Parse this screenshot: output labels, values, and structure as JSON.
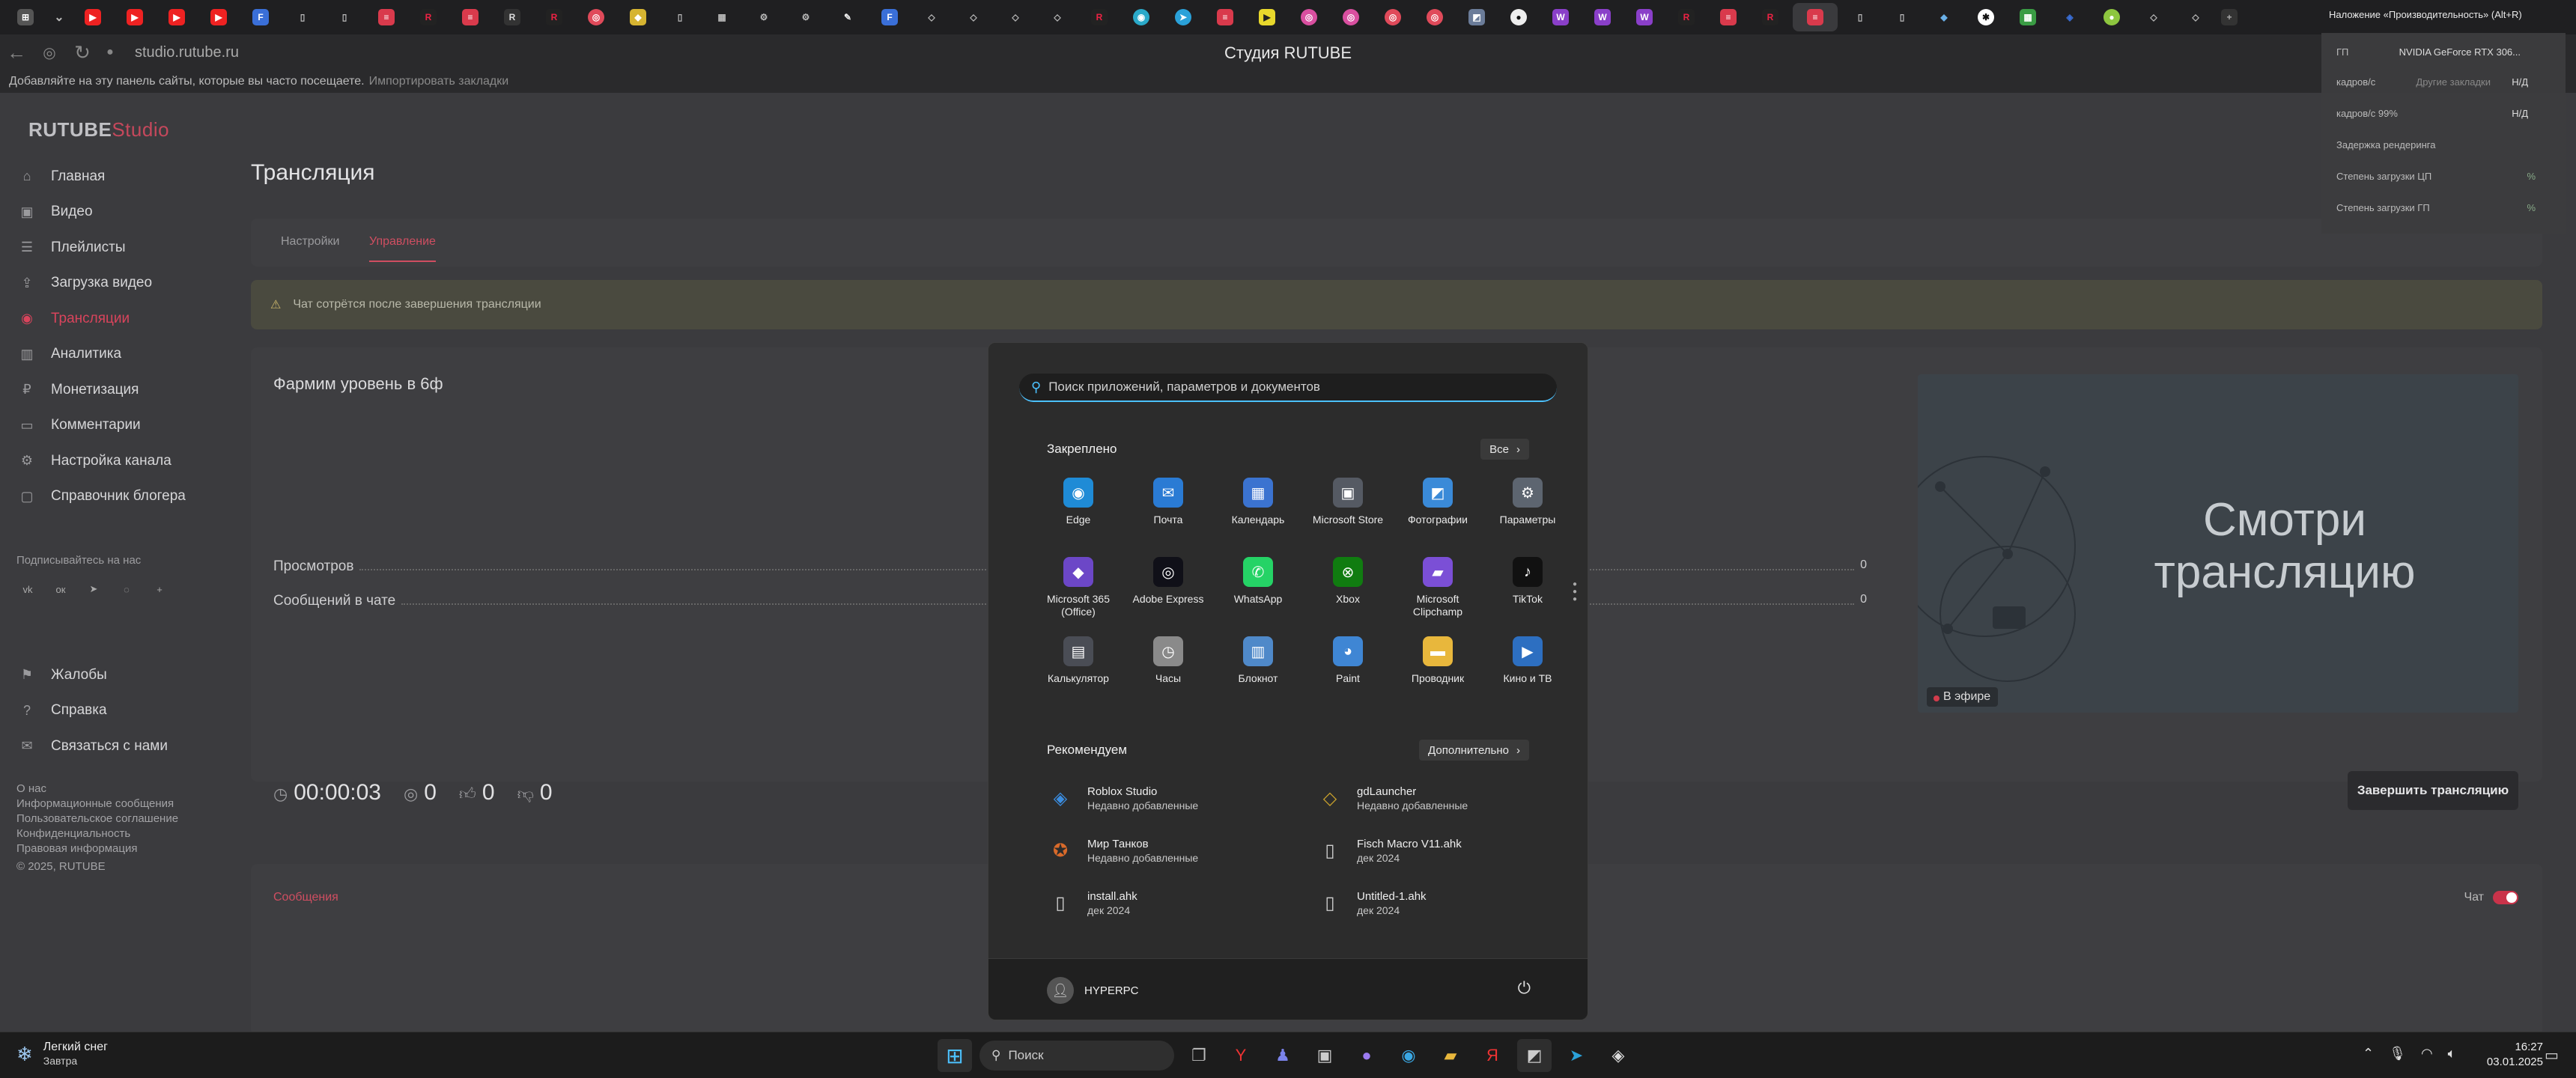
{
  "browser": {
    "url": "studio.rutube.ru",
    "page_title": "Студия RUTUBE",
    "bookmarks_hint": "Добавляйте на эту панель сайты, которые вы часто посещаете.",
    "bookmarks_import": "Импортировать закладки"
  },
  "perf": {
    "hint": "Наложение «Производительность» (Alt+R)",
    "gpu_label": "ГП",
    "gpu_name": "NVIDIA GeForce RTX 306...",
    "fps_label": "кадров/с",
    "fps_value": "Н/Д",
    "fps_low_label": "кадров/с 99%",
    "fps_low_value": "Н/Д",
    "render_latency_label": "Задержка рендеринга",
    "cpu_label": "Степень загрузки ЦП",
    "cpu_value": "%",
    "gpu_load_label": "Степень загрузки ГП",
    "gpu_load_value": "%",
    "other_bookmarks": "Другие закладки"
  },
  "sidebar": {
    "logo_main": "RUTUBE",
    "logo_studio": "Studio",
    "items": [
      {
        "label": "Главная",
        "icon": "home-icon"
      },
      {
        "label": "Видео",
        "icon": "video-icon"
      },
      {
        "label": "Плейлисты",
        "icon": "playlist-icon"
      },
      {
        "label": "Загрузка видео",
        "icon": "upload-icon"
      },
      {
        "label": "Трансляции",
        "icon": "broadcast-icon"
      },
      {
        "label": "Аналитика",
        "icon": "analytics-icon"
      },
      {
        "label": "Монетизация",
        "icon": "monetization-icon"
      },
      {
        "label": "Комментарии",
        "icon": "comments-icon"
      },
      {
        "label": "Настройка канала",
        "icon": "settings-icon"
      },
      {
        "label": "Справочник блогера",
        "icon": "book-icon"
      }
    ],
    "follow_label": "Подписывайтесь на нас",
    "secondary_items": [
      {
        "label": "Жалобы",
        "icon": "flag-icon"
      },
      {
        "label": "Справка",
        "icon": "help-icon"
      },
      {
        "label": "Связаться с нами",
        "icon": "mail-icon"
      }
    ],
    "footer_links": [
      "О нас",
      "Информационные сообщения",
      "Пользовательское соглашение",
      "Конфиденциальность",
      "Правовая информация",
      "© 2025, RUTUBE"
    ]
  },
  "main": {
    "title": "Трансляция",
    "tabs": [
      "Настройки",
      "Управление"
    ],
    "notice": "Чат сотрётся после завершения трансляции",
    "stream_title": "Фармим уровень в 6ф",
    "stats": [
      {
        "label": "Просмотров",
        "value": "0"
      },
      {
        "label": "Сообщений в чате",
        "value": "0"
      }
    ],
    "timer": "00:00:03",
    "viewers": "0",
    "likes": "0",
    "dislikes": "0",
    "preview_text": "Смотри трансляцию",
    "live_badge": "В эфире",
    "end_button": "Завершить трансляцию",
    "messages_tab": "Сообщения",
    "chat_label": "Чат"
  },
  "start_menu": {
    "search_placeholder": "Поиск приложений, параметров и документов",
    "pinned_label": "Закреплено",
    "all_button": "Все",
    "pinned": [
      {
        "name": "Edge",
        "icon": "edge-icon",
        "color": "#1f8bd6"
      },
      {
        "name": "Почта",
        "icon": "mail-icon",
        "color": "#2a7bd4"
      },
      {
        "name": "Календарь",
        "icon": "calendar-icon",
        "color": "#3b73d0"
      },
      {
        "name": "Microsoft Store",
        "icon": "store-icon",
        "color": "#555a63"
      },
      {
        "name": "Фотографии",
        "icon": "photos-icon",
        "color": "#3a8ad8"
      },
      {
        "name": "Параметры",
        "icon": "gear-icon",
        "color": "#5d6570"
      },
      {
        "name": "Microsoft 365 (Office)",
        "icon": "office-icon",
        "color": "#6c47c7"
      },
      {
        "name": "Adobe Express",
        "icon": "adobe-express-icon",
        "color": "#101018"
      },
      {
        "name": "WhatsApp",
        "icon": "whatsapp-icon",
        "color": "#25d366"
      },
      {
        "name": "Xbox",
        "icon": "xbox-icon",
        "color": "#107c10"
      },
      {
        "name": "Microsoft Clipchamp",
        "icon": "clipchamp-icon",
        "color": "#7b4fd6"
      },
      {
        "name": "TikTok",
        "icon": "tiktok-icon",
        "color": "#111111"
      },
      {
        "name": "Калькулятор",
        "icon": "calculator-icon",
        "color": "#4a4d55"
      },
      {
        "name": "Часы",
        "icon": "clock-icon",
        "color": "#8a8a8a"
      },
      {
        "name": "Блокнот",
        "icon": "notepad-icon",
        "color": "#4f89c9"
      },
      {
        "name": "Paint",
        "icon": "paint-icon",
        "color": "#3f86d4"
      },
      {
        "name": "Проводник",
        "icon": "folder-icon",
        "color": "#e8b73c"
      },
      {
        "name": "Кино и ТВ",
        "icon": "movies-icon",
        "color": "#2d6fc1"
      }
    ],
    "recommended_label": "Рекомендуем",
    "more_button": "Дополнительно",
    "recommended": [
      {
        "title": "Roblox Studio",
        "sub": "Недавно добавленные",
        "icon": "roblox-icon",
        "color": "#3b8de0"
      },
      {
        "title": "gdLauncher",
        "sub": "Недавно добавленные",
        "icon": "gdlauncher-icon",
        "color": "#c9a12c"
      },
      {
        "title": "Мир Танков",
        "sub": "Недавно добавленные",
        "icon": "tanks-icon",
        "color": "#d96a2a"
      },
      {
        "title": "Fisch Macro V11.ahk",
        "sub": "дек 2024",
        "icon": "file-icon",
        "color": "#cfcfcf"
      },
      {
        "title": "install.ahk",
        "sub": "дек 2024",
        "icon": "file-icon",
        "color": "#cfcfcf"
      },
      {
        "title": "Untitled-1.ahk",
        "sub": "дек 2024",
        "icon": "file-icon",
        "color": "#cfcfcf"
      }
    ],
    "user": "HYPERPC"
  },
  "taskbar": {
    "weather_title": "Легкий снег",
    "weather_sub": "Завтра",
    "search": "Поиск",
    "time": "16:27",
    "date": "03.01.2025"
  }
}
